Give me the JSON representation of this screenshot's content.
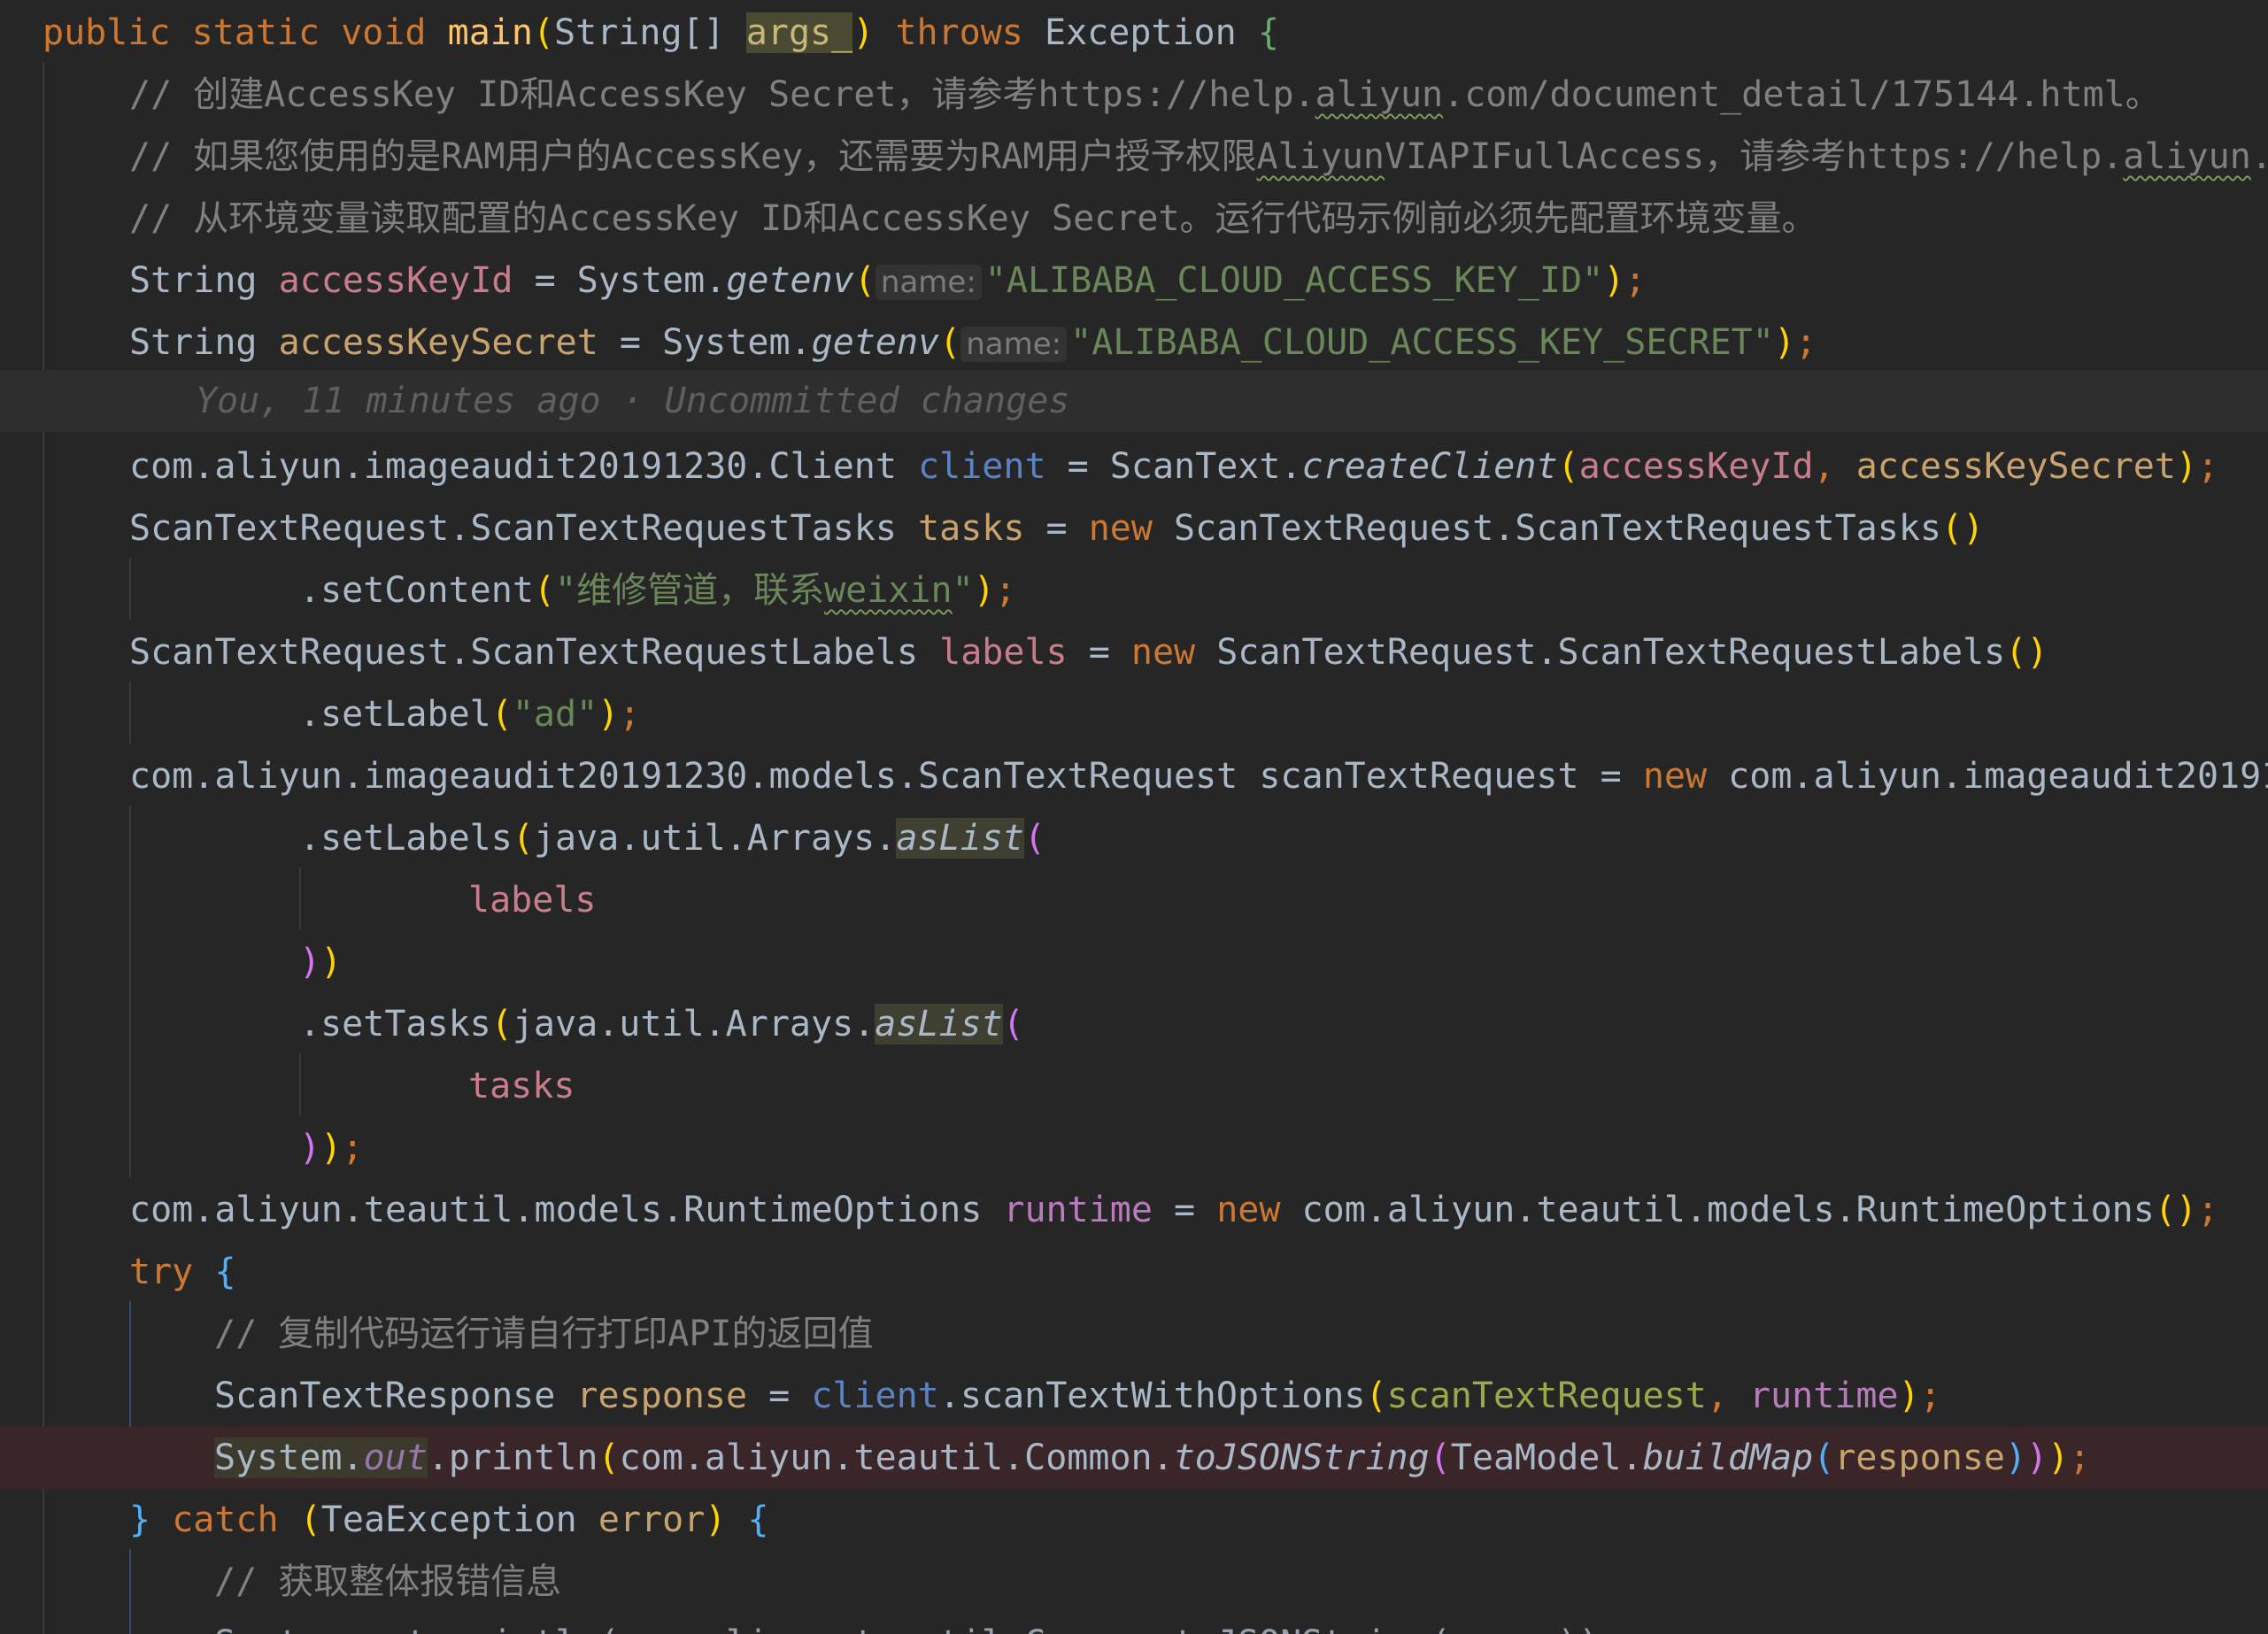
{
  "editor": {
    "line01": {
      "t1": "public",
      "t2": "static",
      "t3": "void",
      "fn": "main",
      "open": "(",
      "type": "String[]",
      "arg": "args_",
      "close": ")",
      "throws": "throws",
      "ex": "Exception",
      "brace": "{"
    },
    "line02": {
      "comment": "// 创建AccessKey ID和AccessKey Secret，请参考https://help.",
      "sq": "aliyun",
      "rest": ".com/document_detail/175144.html。"
    },
    "line03": {
      "comment": "// 如果您使用的是RAM用户的AccessKey，还需要为RAM用户授予权限",
      "sq": "Aliyun",
      "mid": "VIAPIFullAccess，请参考https://help.",
      "sq2": "aliyun",
      "end": "."
    },
    "line04": {
      "comment": "// 从环境变量读取配置的AccessKey ID和AccessKey Secret。运行代码示例前必须先配置环境变量。"
    },
    "line05": {
      "type": "String ",
      "var": "accessKeyId",
      "eq": " = ",
      "cls": "System.",
      "fn": "getenv",
      "open": "(",
      "hint": "name:",
      "str": "\"ALIBABA_CLOUD_ACCESS_KEY_ID\"",
      "close": ")",
      "semi": ";"
    },
    "line06": {
      "type": "String ",
      "var": "accessKeySecret",
      "eq": " = ",
      "cls": "System.",
      "fn": "getenv",
      "open": "(",
      "hint": "name:",
      "str": "\"ALIBABA_CLOUD_ACCESS_KEY_SECRET\"",
      "close": ")",
      "semi": ";"
    },
    "line07": {
      "blame": "You, 11 minutes ago · Uncommitted changes"
    },
    "line08": {
      "type": "com.aliyun.imageaudit20191230.Client ",
      "var": "client",
      "eq": " = ",
      "cls": "ScanText.",
      "fn": "createClient",
      "open": "(",
      "a1": "accessKeyId",
      "comma": ", ",
      "a2": "accessKeySecret",
      "close": ")",
      "semi": ";"
    },
    "line09": {
      "type": "ScanTextRequest.ScanTextRequestTasks ",
      "var": "tasks",
      "eq": " = ",
      "new": "new",
      "ctor": " ScanTextRequest.ScanTextRequestTasks",
      "parens": "()"
    },
    "line10": {
      "call": ".setContent",
      "open": "(",
      "str": "\"维修管道，联系",
      "sq": "weixin",
      "strend": "\"",
      "close": ")",
      "semi": ";"
    },
    "line11": {
      "type": "ScanTextRequest.ScanTextRequestLabels ",
      "var": "labels",
      "eq": " = ",
      "new": "new",
      "ctor": " ScanTextRequest.ScanTextRequestLabels",
      "parens": "()"
    },
    "line12": {
      "call": ".setLabel",
      "open": "(",
      "str": "\"ad\"",
      "close": ")",
      "semi": ";"
    },
    "line13": {
      "type": "com.aliyun.imageaudit20191230.models.ScanTextRequest scanTextRequest = ",
      "new": "new",
      "ctor": " com.aliyun.imageaudit20191"
    },
    "line14": {
      "call": ".setLabels",
      "open": "(",
      "pkg": "java.util.Arrays.",
      "fn": "asList",
      "open2": "("
    },
    "line15": {
      "var": "labels"
    },
    "line16": {
      "c1": ")",
      "c2": ")"
    },
    "line17": {
      "call": ".setTasks",
      "open": "(",
      "pkg": "java.util.Arrays.",
      "fn": "asList",
      "open2": "("
    },
    "line18": {
      "var": "tasks"
    },
    "line19": {
      "c1": ")",
      "c2": ")",
      "semi": ";"
    },
    "line20": {
      "type": "com.aliyun.teautil.models.RuntimeOptions ",
      "var": "runtime",
      "eq": " = ",
      "new": "new",
      "ctor": " com.aliyun.teautil.models.RuntimeOptions",
      "parens": "()",
      "semi": ";"
    },
    "line21": {
      "kw": "try",
      "brace": "{"
    },
    "line22": {
      "comment": "// 复制代码运行请自行打印API的返回值"
    },
    "line23": {
      "type": "ScanTextResponse ",
      "var": "response",
      "eq": " = ",
      "obj": "client",
      "call": ".scanTextWithOptions",
      "open": "(",
      "a1": "scanTextRequest",
      "comma": ", ",
      "a2": "runtime",
      "close": ")",
      "semi": ";"
    },
    "line24": {
      "sys": "System.",
      "out": "out",
      "call": ".println",
      "open": "(",
      "pkg": "com.aliyun.teautil.Common.",
      "fn": "toJSONString",
      "open2": "(",
      "cls": "TeaModel.",
      "fn2": "buildMap",
      "open3": "(",
      "arg": "response",
      "close3": ")",
      "close2": ")",
      "close": ")",
      "semi": ";"
    },
    "line25": {
      "brace1": "}",
      "kw": "catch",
      "open": " (",
      "type": "TeaException ",
      "var": "error",
      "close": ")",
      "brace": "{"
    },
    "line26": {
      "comment": "// 获取整体报错信息"
    },
    "line27": {
      "partial": "System.out.println(com.aliyun.teautil.Common.toJSONString(error))"
    }
  }
}
